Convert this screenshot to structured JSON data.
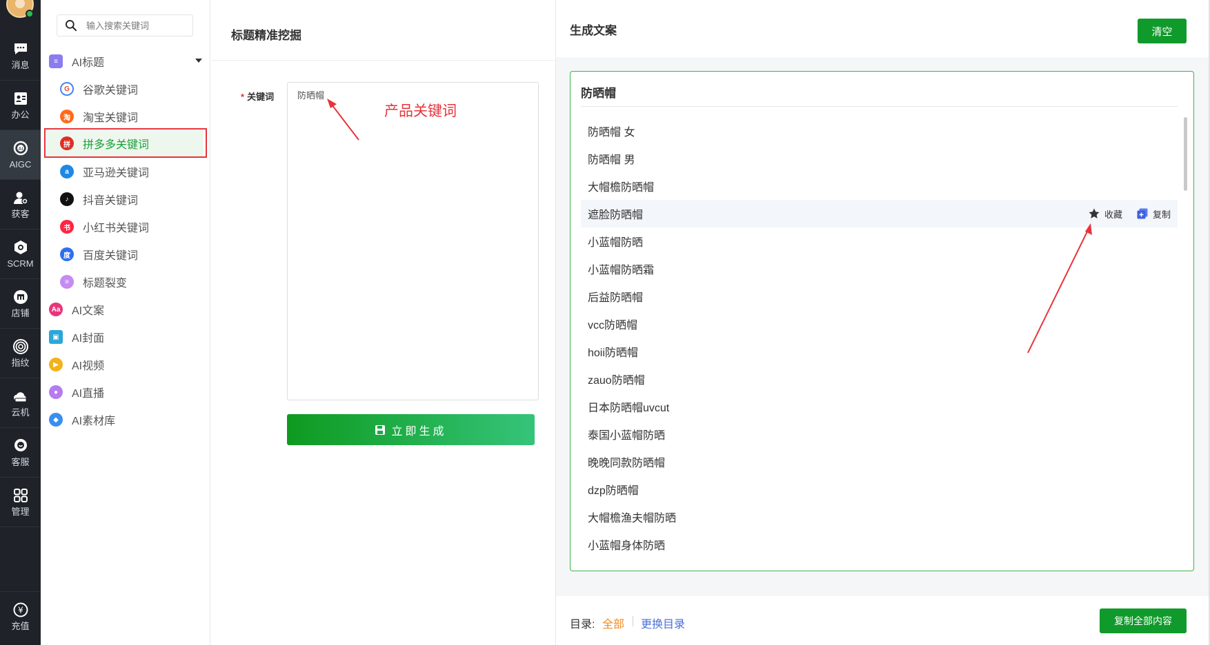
{
  "rail": {
    "items": [
      {
        "label": "消息",
        "icon": "message-icon"
      },
      {
        "label": "办公",
        "icon": "office-icon"
      },
      {
        "label": "AIGC",
        "icon": "aigc-icon"
      },
      {
        "label": "获客",
        "icon": "acquire-icon"
      },
      {
        "label": "SCRM",
        "icon": "scrm-icon"
      },
      {
        "label": "店铺",
        "icon": "shop-icon"
      },
      {
        "label": "指纹",
        "icon": "fingerprint-icon"
      },
      {
        "label": "云机",
        "icon": "cloud-phone-icon"
      },
      {
        "label": "客服",
        "icon": "service-icon"
      },
      {
        "label": "管理",
        "icon": "manage-icon"
      }
    ],
    "recharge": "充值"
  },
  "menu": {
    "search_placeholder": "输入搜索关键词",
    "ai_title": "AI标题",
    "sub_items": [
      {
        "label": "谷歌关键词",
        "color": "#4285f4",
        "glyph": "G"
      },
      {
        "label": "淘宝关键词",
        "color": "#ff6a1a",
        "glyph": "淘"
      },
      {
        "label": "拼多多关键词",
        "color": "#e02e24",
        "glyph": "拼"
      },
      {
        "label": "亚马逊关键词",
        "color": "#1e88e5",
        "glyph": "a"
      },
      {
        "label": "抖音关键词",
        "color": "#111111",
        "glyph": "♪"
      },
      {
        "label": "小红书关键词",
        "color": "#ff2442",
        "glyph": "书"
      },
      {
        "label": "百度关键词",
        "color": "#2f6ef0",
        "glyph": "度"
      },
      {
        "label": "标题裂变",
        "color": "#c58bf0",
        "glyph": "≡"
      }
    ],
    "top_items": [
      {
        "label": "AI文案",
        "color": "#e8357a",
        "glyph": "Aa"
      },
      {
        "label": "AI封面",
        "color": "#2aa7d8",
        "glyph": "▣"
      },
      {
        "label": "AI视频",
        "color": "#f2b21a",
        "glyph": "▶"
      },
      {
        "label": "AI直播",
        "color": "#b47cf0",
        "glyph": "●"
      },
      {
        "label": "AI素材库",
        "color": "#3a8ef0",
        "glyph": "◆"
      }
    ]
  },
  "middle": {
    "title": "标题精准挖掘",
    "keyword_label": "关键词",
    "required_mark": "*",
    "keyword_value": "防晒帽",
    "annotation": "产品关键词",
    "generate_label": "立即生成"
  },
  "right": {
    "title": "生成文案",
    "clear_label": "清空",
    "card_title": "防晒帽",
    "results": [
      "防晒帽 女",
      "防晒帽 男",
      "大帽檐防晒帽",
      "遮脸防晒帽",
      "小蓝帽防晒",
      "小蓝帽防晒霜",
      "后益防晒帽",
      "vcc防晒帽",
      "hoii防晒帽",
      "zauo防晒帽",
      "日本防晒帽uvcut",
      "泰国小蓝帽防晒",
      "晚晚同款防晒帽",
      "dzp防晒帽",
      "大帽檐渔夫帽防晒",
      "小蓝帽身体防晒",
      "..."
    ],
    "hover_index": 3,
    "favorite_label": "收藏",
    "copy_label": "复制",
    "directory_label": "目录:",
    "directory_all": "全部",
    "directory_change": "更换目录",
    "copy_all_label": "复制全部内容"
  },
  "colors": {
    "accent_green": "#119a2c",
    "annotation_red": "#e8333a",
    "link_orange": "#f08a1c",
    "link_blue": "#4a6fd8"
  }
}
